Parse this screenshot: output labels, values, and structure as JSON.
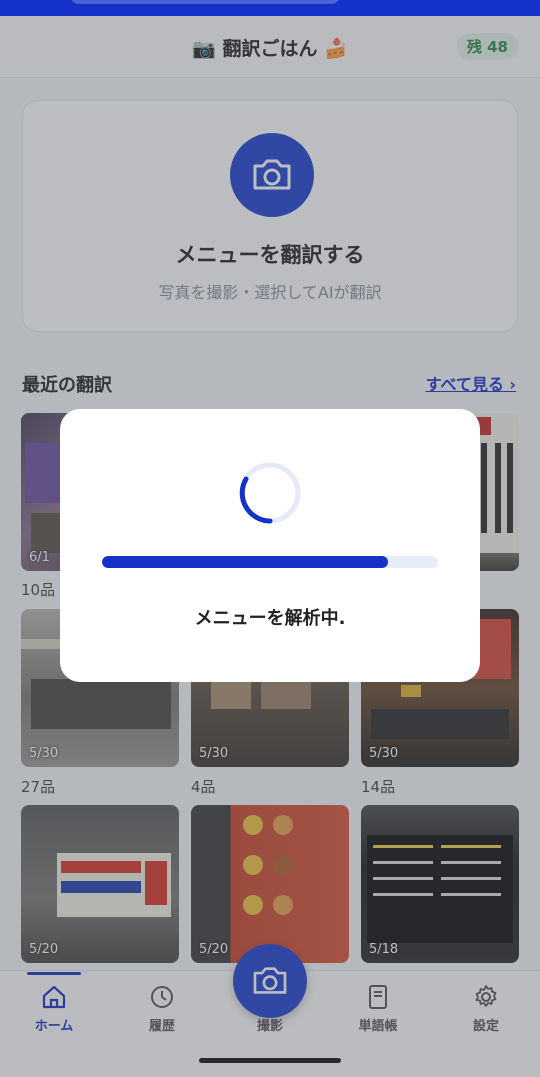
{
  "header": {
    "title": "📷 翻訳ごはん 🍰",
    "credits": "残 48"
  },
  "upload": {
    "title": "メニューを翻訳する",
    "subtitle": "写真を撮影・選択してAIが翻訳"
  },
  "recent": {
    "heading": "最近の翻訳",
    "see_all": "すべて見る",
    "items": [
      {
        "date": "6/1",
        "count": "10品"
      },
      {
        "date": "",
        "count": ""
      },
      {
        "date": "",
        "count": ""
      },
      {
        "date": "5/30",
        "count": "27品"
      },
      {
        "date": "5/30",
        "count": "4品"
      },
      {
        "date": "5/30",
        "count": "14品"
      },
      {
        "date": "5/20",
        "count": ""
      },
      {
        "date": "5/20",
        "count": ""
      },
      {
        "date": "5/18",
        "count": ""
      }
    ]
  },
  "tabs": [
    {
      "label": "ホーム",
      "icon": "home-icon",
      "active": true
    },
    {
      "label": "履歴",
      "icon": "history-icon"
    },
    {
      "label": "撮影",
      "icon": "camera-icon"
    },
    {
      "label": "単語帳",
      "icon": "book-icon"
    },
    {
      "label": "設定",
      "icon": "gear-icon"
    }
  ],
  "modal": {
    "message": "メニューを解析中.",
    "progress": 0.85
  },
  "colors": {
    "accent": "#1532c8",
    "badge_green": "#2f8a4a"
  }
}
